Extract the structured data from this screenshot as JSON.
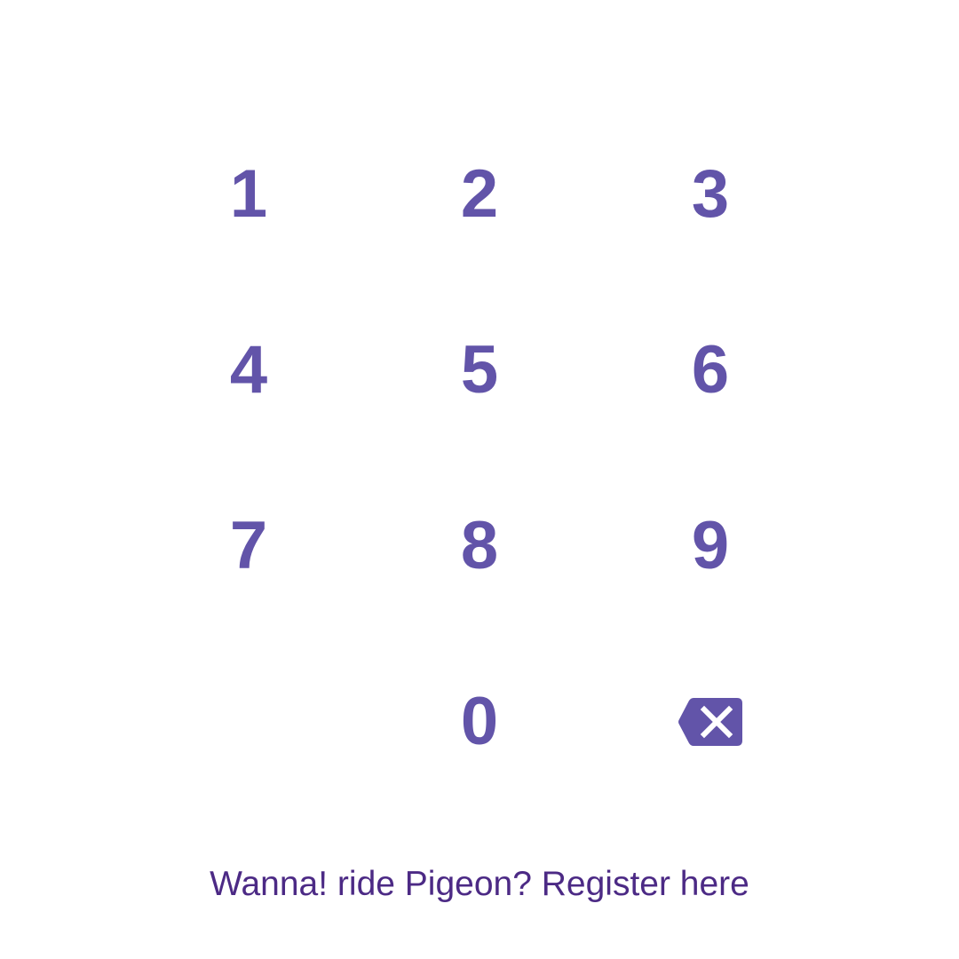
{
  "colors": {
    "background": "#ffffff",
    "key_text": "#6254a9",
    "link_text": "#4c2a85"
  },
  "keypad": {
    "keys": [
      "1",
      "2",
      "3",
      "4",
      "5",
      "6",
      "7",
      "8",
      "9",
      "",
      "0",
      "backspace"
    ],
    "backspace_icon": "backspace-icon"
  },
  "footer": {
    "register_text": "Wanna! ride Pigeon? Register here"
  }
}
